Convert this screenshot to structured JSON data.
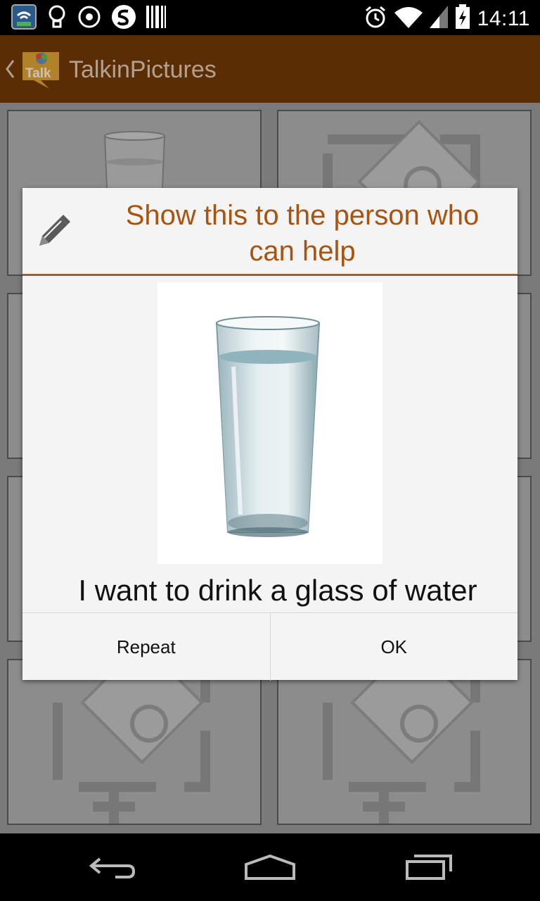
{
  "status_bar": {
    "time": "14:11",
    "left_icons": [
      "wifi-app-icon",
      "lightbulb-icon",
      "target-icon",
      "s-circle-icon",
      "barcode-icon"
    ],
    "right_icons": [
      "alarm-icon",
      "wifi-signal-icon",
      "cell-signal-icon",
      "battery-charging-icon"
    ]
  },
  "action_bar": {
    "up_icon": "chevron-left-icon",
    "app_icon": "talk-logo-icon",
    "app_icon_text": "Talk",
    "title": "TalkinPictures"
  },
  "grid": {
    "tiles": [
      {
        "content": "glass-of-water"
      },
      {
        "content": "add-picture-placeholder"
      },
      {
        "content": "add-picture-placeholder"
      },
      {
        "content": "add-picture-placeholder"
      },
      {
        "content": "add-picture-placeholder"
      },
      {
        "content": "add-picture-placeholder"
      },
      {
        "content": "add-picture-placeholder"
      },
      {
        "content": "add-picture-placeholder"
      }
    ]
  },
  "dialog": {
    "icon": "pencil-icon",
    "title": "Show this to the person who can help",
    "image": "glass-of-water",
    "message": "I want to drink a glass of water",
    "buttons": {
      "repeat": "Repeat",
      "ok": "OK"
    }
  },
  "nav_bar": {
    "icons": [
      "back-icon",
      "home-icon",
      "recent-apps-icon"
    ]
  },
  "colors": {
    "action_bar": "#5a2d04",
    "accent": "#a85410",
    "divider": "#b35a10",
    "dim_overlay": "#7a7a7a"
  }
}
